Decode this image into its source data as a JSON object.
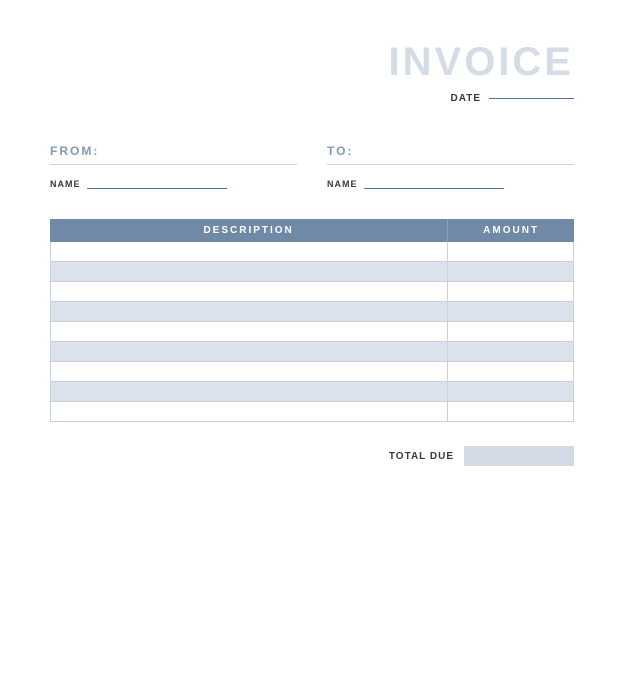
{
  "header": {
    "title": "INVOICE",
    "date_label": "DATE",
    "date_value": ""
  },
  "parties": {
    "from": {
      "label": "FROM:",
      "name_label": "NAME",
      "name_value": ""
    },
    "to": {
      "label": "TO:",
      "name_label": "NAME",
      "name_value": ""
    }
  },
  "table": {
    "columns": {
      "description": "DESCRIPTION",
      "amount": "AMOUNT"
    },
    "rows": [
      {
        "description": "",
        "amount": ""
      },
      {
        "description": "",
        "amount": ""
      },
      {
        "description": "",
        "amount": ""
      },
      {
        "description": "",
        "amount": ""
      },
      {
        "description": "",
        "amount": ""
      },
      {
        "description": "",
        "amount": ""
      },
      {
        "description": "",
        "amount": ""
      },
      {
        "description": "",
        "amount": ""
      },
      {
        "description": "",
        "amount": ""
      }
    ]
  },
  "total": {
    "label": "TOTAL DUE",
    "value": ""
  }
}
